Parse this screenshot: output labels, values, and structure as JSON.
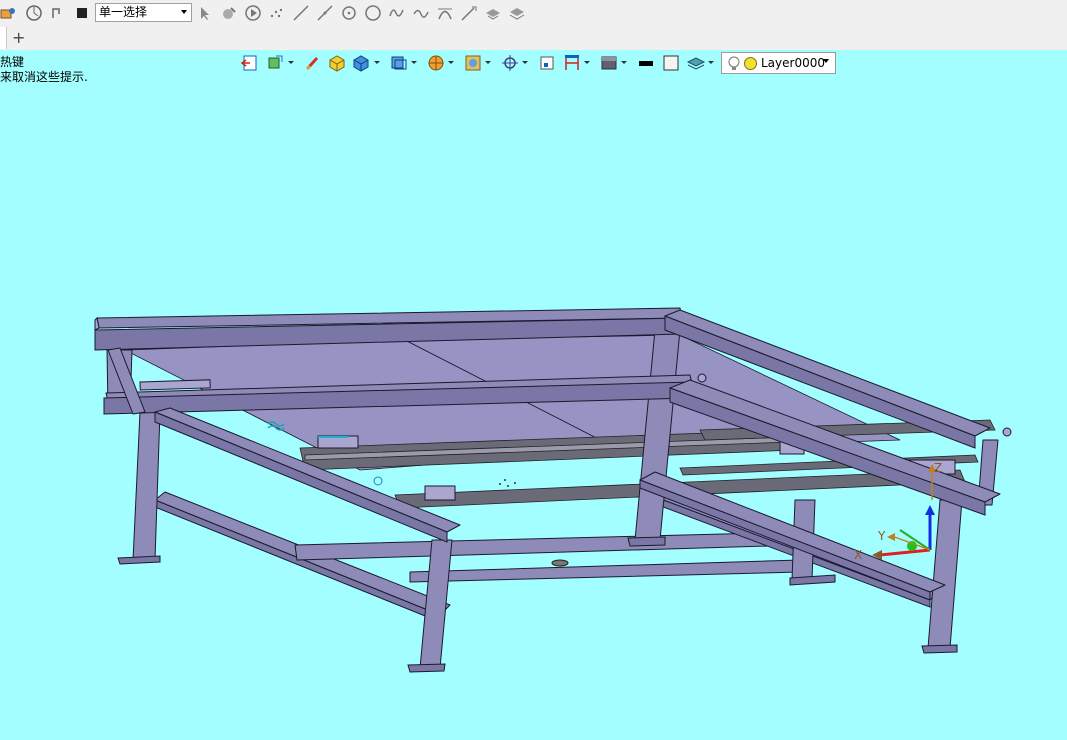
{
  "toolbar": {
    "selection_mode": "单一选择",
    "icons": [
      "layer-swap-icon",
      "snap-icon",
      "undo-icon",
      "stop-icon",
      "pointer-icon",
      "filter-icon",
      "play-icon",
      "point-icon",
      "line-icon",
      "line2-icon",
      "circle-center-icon",
      "circle-icon",
      "wave-icon",
      "curve-icon",
      "arc-icon",
      "extend-icon",
      "plane-icon",
      "plane2-icon"
    ]
  },
  "tabs": {
    "add_label": "+"
  },
  "hint": {
    "line1": "热键",
    "line2": "来取消这些提示."
  },
  "view_toolbar": {
    "layer_name": "Layer0000",
    "icons": [
      "exit-view-icon",
      "render-mode-icon",
      "brush-icon",
      "box-color-icon",
      "cube-icon",
      "view-orientation-icon",
      "section-icon",
      "pan-icon",
      "snap-target-icon",
      "fit-window-icon",
      "measure-icon",
      "display-style-icon",
      "line-color-icon",
      "fill-color-icon",
      "layers-icon",
      "bulb-icon"
    ]
  },
  "triad": {
    "x_label": "X",
    "y_label": "Y",
    "z_label": "Z"
  },
  "colors": {
    "viewport_bg": "#a3ffff",
    "frame_fill": "#8f8bb8",
    "frame_edge": "#1a1a2e",
    "rail": "#5a5a5a"
  }
}
